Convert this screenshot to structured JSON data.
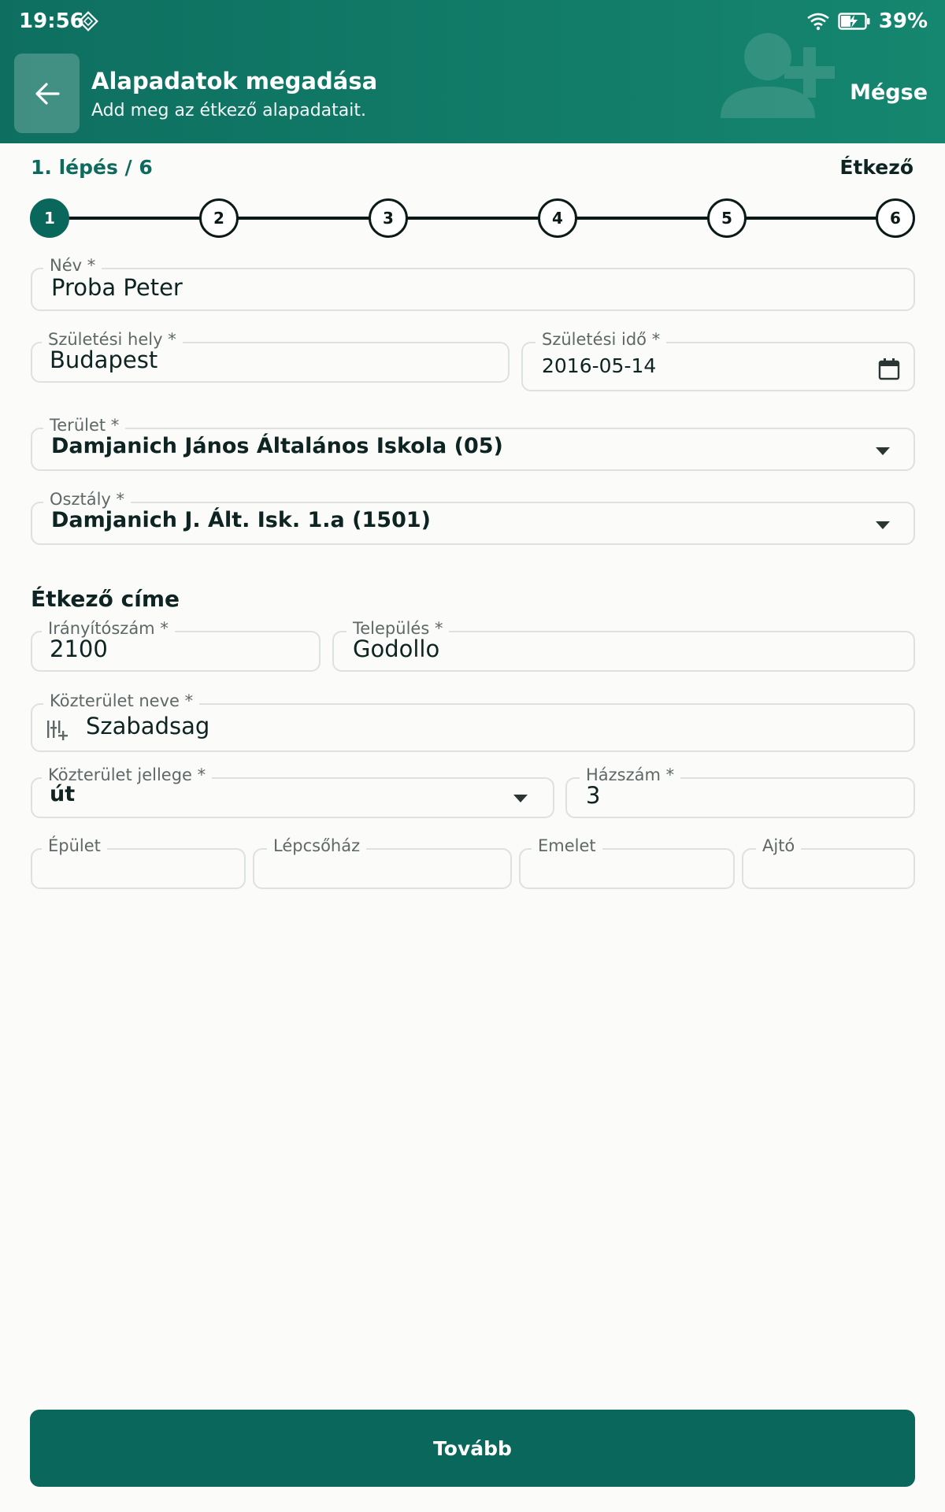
{
  "status_bar": {
    "time": "19:56",
    "battery": "39%"
  },
  "header": {
    "title": "Alapadatok megadása",
    "subtitle": "Add meg az étkező alapadatait.",
    "cancel_label": "Mégse"
  },
  "steps": {
    "label": "1. lépés / 6",
    "name": "Étkező",
    "items": [
      "1",
      "2",
      "3",
      "4",
      "5",
      "6"
    ],
    "active": 1
  },
  "form": {
    "name": {
      "label": "Név *",
      "value": "Proba Peter"
    },
    "birth_place": {
      "label": "Születési hely *",
      "value": "Budapest"
    },
    "birth_date": {
      "label": "Születési idő *",
      "value": "2016-05-14"
    },
    "area": {
      "label": "Terület *",
      "value": "Damjanich János Általános Iskola (05)"
    },
    "class": {
      "label": "Osztály *",
      "value": "Damjanich J. Ált. Isk. 1.a (1501)"
    }
  },
  "address": {
    "section_title": "Étkező címe",
    "zip": {
      "label": "Irányítószám *",
      "value": "2100"
    },
    "city": {
      "label": "Település *",
      "value": "Godollo"
    },
    "street_name": {
      "label": "Közterület neve *",
      "value": "Szabadsag"
    },
    "street_type": {
      "label": "Közterület jellege *",
      "value": "út"
    },
    "house_number": {
      "label": "Házszám *",
      "value": "3"
    },
    "building": {
      "label": "Épület",
      "value": ""
    },
    "staircase": {
      "label": "Lépcsőház",
      "value": ""
    },
    "floor": {
      "label": "Emelet",
      "value": ""
    },
    "door": {
      "label": "Ajtó",
      "value": ""
    }
  },
  "footer": {
    "next_label": "Tovább"
  },
  "colors": {
    "primary": "#0a675b",
    "header_start": "#0e6f60",
    "header_end": "#15866f"
  }
}
